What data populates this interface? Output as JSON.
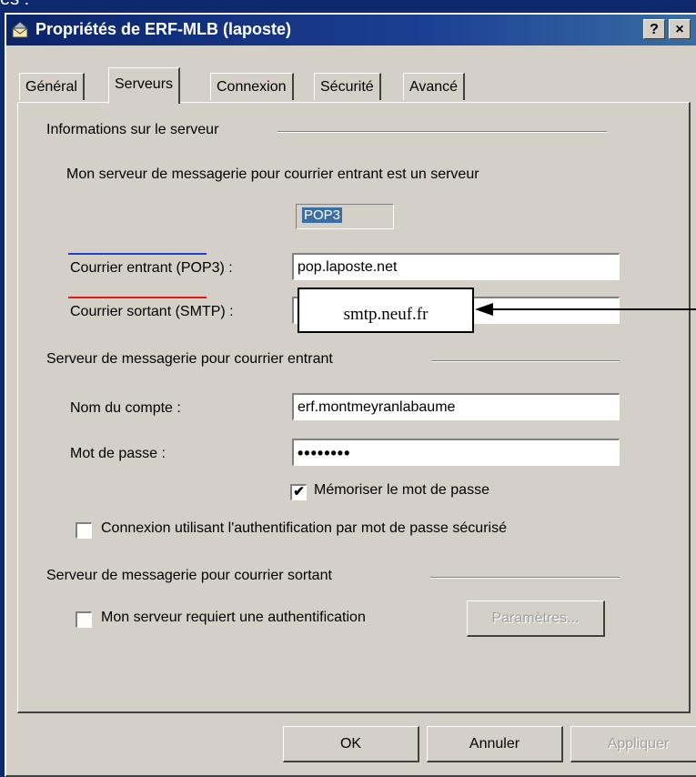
{
  "slide": {
    "partial_text": "es :"
  },
  "window": {
    "title": "Propriétés de ERF-MLB (laposte)",
    "help_label": "?",
    "close_label": "×"
  },
  "tabs": [
    {
      "label": "Général",
      "active": false
    },
    {
      "label": "Serveurs",
      "active": true
    },
    {
      "label": "Connexion",
      "active": false
    },
    {
      "label": "Sécurité",
      "active": false
    },
    {
      "label": "Avancé",
      "active": false
    }
  ],
  "server_info": {
    "group_label": "Informations sur le serveur",
    "incoming_type_text": "Mon serveur de messagerie pour courrier entrant est un serveur",
    "incoming_type_value": "POP3",
    "incoming_label": "Courrier entrant (POP3) :",
    "incoming_value": "pop.laposte.net",
    "outgoing_label": "Courrier sortant (SMTP) :",
    "outgoing_value": "",
    "callout_text": "smtp.neuf.fr"
  },
  "incoming_server": {
    "group_label": "Serveur de messagerie pour courrier entrant",
    "account_label": "Nom du compte :",
    "account_value": "erf.montmeyranlabaume",
    "password_label": "Mot de passe :",
    "password_value": "••••••••",
    "remember_label": "Mémoriser le mot de passe",
    "remember_checked": true,
    "secure_auth_label": "Connexion utilisant l'authentification par mot de passe sécurisé",
    "secure_auth_checked": false
  },
  "outgoing_server": {
    "group_label": "Serveur de messagerie pour courrier sortant",
    "requires_auth_label": "Mon serveur requiert une authentification",
    "requires_auth_checked": false,
    "settings_button": "Paramètres..."
  },
  "buttons": {
    "ok": "OK",
    "cancel": "Annuler",
    "apply": "Appliquer"
  },
  "colors": {
    "title_bar": "#0a246a",
    "dialog_bg": "#d4d0c8",
    "blue_underline": "#1d3fd8",
    "red_underline": "#e01818",
    "selection": "#3a6ea5"
  },
  "icons": {
    "title_icon": "mail-properties-icon",
    "arrow": "left-arrow-icon"
  }
}
